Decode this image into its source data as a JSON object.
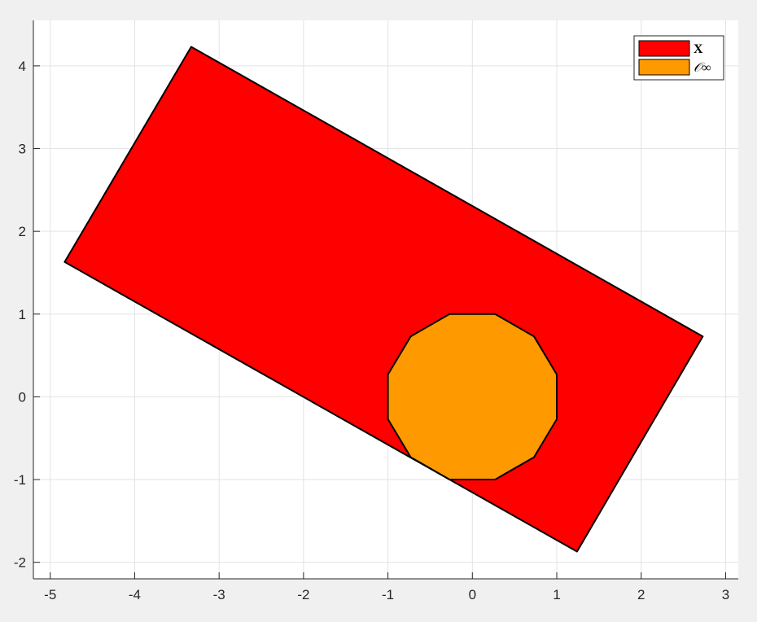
{
  "chart_data": {
    "type": "area",
    "title": "",
    "xlabel": "",
    "ylabel": "",
    "xlim": [
      -5.2,
      3.15
    ],
    "ylim": [
      -2.2,
      4.55
    ],
    "xticks": [
      -5,
      -4,
      -3,
      -2,
      -1,
      0,
      1,
      2,
      3
    ],
    "yticks": [
      -2,
      -1,
      0,
      1,
      2,
      3,
      4
    ],
    "grid": true,
    "legend_position": "top-right",
    "series": [
      {
        "name": "X",
        "color": "#ff0000",
        "edge_color": "#000000",
        "x": [
          -3.33,
          2.73,
          1.24,
          -4.83
        ],
        "y": [
          4.23,
          0.73,
          -1.87,
          1.63
        ]
      },
      {
        "name": "𝒪∞",
        "color": "#ff9900",
        "edge_color": "#000000",
        "x": [
          -0.27,
          0.27,
          0.73,
          1.0,
          1.0,
          0.73,
          0.27,
          -0.27,
          -0.73,
          -1.0,
          -1.0,
          -0.73
        ],
        "y": [
          1.0,
          1.0,
          0.73,
          0.27,
          -0.27,
          -0.73,
          -1.0,
          -1.0,
          -0.73,
          -0.27,
          0.27,
          0.73
        ]
      }
    ]
  }
}
